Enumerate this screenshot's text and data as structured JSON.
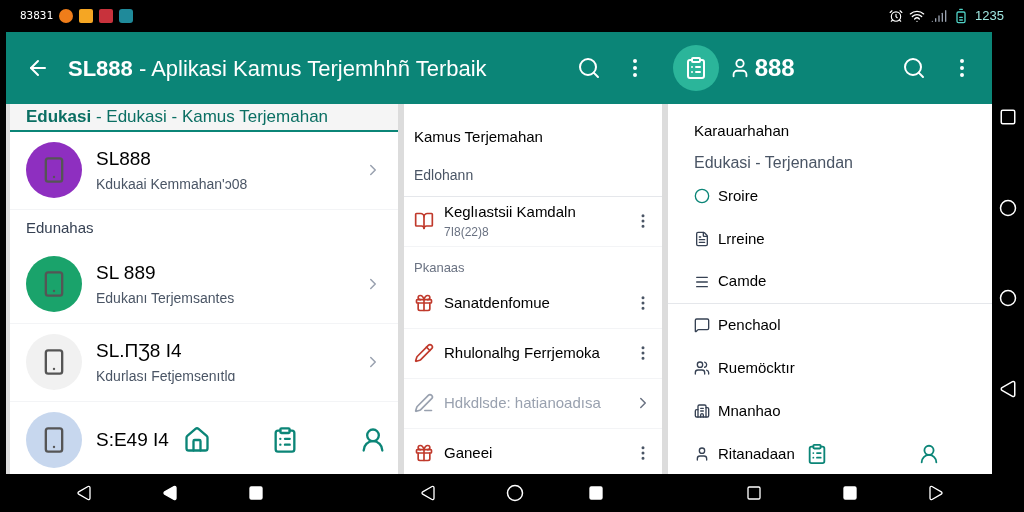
{
  "status_bar": {
    "carrier": "83831",
    "time": "1235"
  },
  "app_bar": {
    "title": "**SL888** - Aplikasi Kamus Terjemhhñ Terbaik",
    "second_title": "888"
  },
  "left_panel": {
    "tab": {
      "label": "**Edukasi** - Edukasi - Kamus Terjemahan",
      "selected": true
    },
    "items": [
      {
        "kind": "app",
        "title": "SL888",
        "subtitle": "Kdukaai Kemmahan'ɔ08",
        "color": "#8e2fc0"
      },
      {
        "kind": "section",
        "title": "Edunahas"
      },
      {
        "kind": "app",
        "title": "SL  889",
        "subtitle": "Edukanı Terjemsantes",
        "color": "#1aa36b"
      },
      {
        "kind": "app",
        "title": "SL.ΠƷ8  I4",
        "subtitle": "Kdurlası Fetjemsenıtlɑ",
        "color": "#f1f1f1"
      },
      {
        "kind": "app",
        "title": "S:E49  I4",
        "color": "#c7d7ee"
      }
    ]
  },
  "middle_panel": {
    "title": "Kamus Terjemahan",
    "subtitle": "Edlohann",
    "items": [
      {
        "kind": "row",
        "title": "Keglıastsii Kamdaln",
        "subtitle": "7I8(22)8",
        "has_menu": true,
        "disabled": false
      },
      {
        "kind": "section",
        "title": "Pkanaas"
      },
      {
        "kind": "row",
        "title": "Sanatdenfomue",
        "has_menu": true,
        "disabled": false
      },
      {
        "kind": "row",
        "title": "Rhulonalhg Ferrjemoka",
        "has_menu": true,
        "disabled": false
      },
      {
        "kind": "row",
        "title": "Hdkdlsde: hatianoadısa",
        "has_menu": false,
        "disabled": true
      },
      {
        "kind": "row",
        "title": "Ganeei",
        "has_menu": true,
        "disabled": false
      }
    ]
  },
  "right_panel": {
    "title": "Karauarhahan",
    "subtitle": "Edukasi - Terjenandan",
    "items": [
      {
        "label": "Sroire",
        "divider_after": false
      },
      {
        "label": "Lrreine",
        "divider_after": false
      },
      {
        "label": "Camde",
        "divider_after": true
      },
      {
        "label": "Penchaol",
        "divider_after": false
      },
      {
        "label": "Ruemöcktır",
        "divider_after": false
      },
      {
        "label": "Mnanhao",
        "divider_after": false
      },
      {
        "label": "Ritanadaan",
        "divider_after": false
      }
    ]
  }
}
